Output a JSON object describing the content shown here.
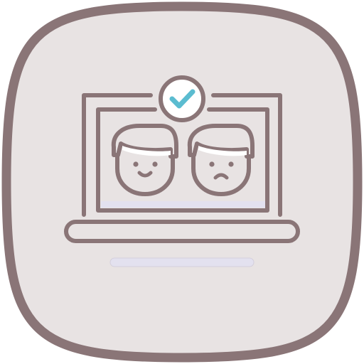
{
  "icon": {
    "name": "laptop-face-comparison-icon",
    "colors": {
      "tile_fill": "#e8e3e3",
      "outline": "#8a7577",
      "accent_lavender": "#e3e1ef",
      "check_accent": "#5bbcd0",
      "check_circle_fill": "#ffffff"
    },
    "parts": {
      "laptop": "laptop-icon",
      "happy_face": "happy-face-icon",
      "sad_face": "sad-face-icon",
      "check_badge": "checkmark-icon"
    }
  }
}
